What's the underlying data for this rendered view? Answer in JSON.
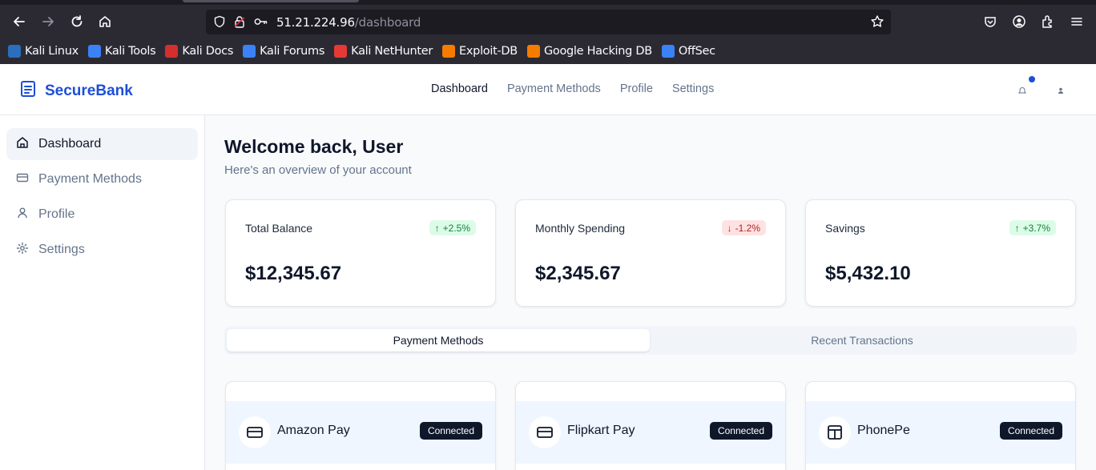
{
  "browser": {
    "url_host": "51.21.224.96",
    "url_path": "/dashboard",
    "bookmarks": [
      {
        "label": "Kali Linux",
        "color": "#2a6ebd"
      },
      {
        "label": "Kali Tools",
        "color": "#3b82f6"
      },
      {
        "label": "Kali Docs",
        "color": "#d32f2f"
      },
      {
        "label": "Kali Forums",
        "color": "#3b82f6"
      },
      {
        "label": "Kali NetHunter",
        "color": "#e53935"
      },
      {
        "label": "Exploit-DB",
        "color": "#f57c00"
      },
      {
        "label": "Google Hacking DB",
        "color": "#f57c00"
      },
      {
        "label": "OffSec",
        "color": "#3b82f6"
      }
    ]
  },
  "header": {
    "brand": "SecureBank",
    "nav": [
      "Dashboard",
      "Payment Methods",
      "Profile",
      "Settings"
    ],
    "active_nav": "Dashboard"
  },
  "sidebar": {
    "items": [
      {
        "label": "Dashboard",
        "icon": "home-icon",
        "active": true
      },
      {
        "label": "Payment Methods",
        "icon": "credit-card-icon",
        "active": false
      },
      {
        "label": "Profile",
        "icon": "user-icon",
        "active": false
      },
      {
        "label": "Settings",
        "icon": "gear-icon",
        "active": false
      }
    ]
  },
  "main": {
    "welcome": "Welcome back, User",
    "subtitle": "Here's an overview of your account",
    "stats": [
      {
        "label": "Total Balance",
        "value": "$12,345.67",
        "change": "+2.5%",
        "direction": "up"
      },
      {
        "label": "Monthly Spending",
        "value": "$2,345.67",
        "change": "-1.2%",
        "direction": "down"
      },
      {
        "label": "Savings",
        "value": "$5,432.10",
        "change": "+3.7%",
        "direction": "up"
      }
    ],
    "tabs": [
      {
        "label": "Payment Methods",
        "active": true
      },
      {
        "label": "Recent Transactions",
        "active": false
      }
    ],
    "payment_methods": [
      {
        "name": "Amazon Pay",
        "status": "Connected"
      },
      {
        "name": "Flipkart Pay",
        "status": "Connected"
      },
      {
        "name": "PhonePe",
        "status": "Connected"
      }
    ]
  },
  "colors": {
    "brand": "#1d4ed8",
    "up": "#15803d",
    "down": "#b91c1c",
    "badge": "#0f172a"
  }
}
